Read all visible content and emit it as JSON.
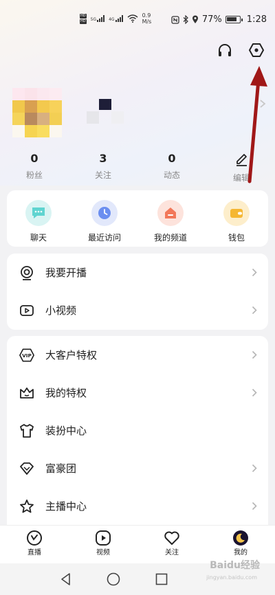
{
  "status_bar": {
    "hd1": "HD",
    "hd2": "HD",
    "net1": "5G",
    "net2": "4G",
    "speed_value": "0.9",
    "speed_unit": "M/s",
    "battery_percent": "77%",
    "time": "1:28"
  },
  "header": {
    "headphones_icon": "headphones-icon",
    "settings_icon": "hexagon-settings-icon"
  },
  "stats": [
    {
      "value": "0",
      "label": "粉丝"
    },
    {
      "value": "3",
      "label": "关注"
    },
    {
      "value": "0",
      "label": "动态"
    }
  ],
  "edit_label": "编辑",
  "quick_actions": [
    {
      "label": "聊天",
      "icon": "chat-icon",
      "color": "#5fd4d0"
    },
    {
      "label": "最近访问",
      "icon": "clock-icon",
      "color": "#6b8ef0"
    },
    {
      "label": "我的频道",
      "icon": "house-icon",
      "color": "#f2785a"
    },
    {
      "label": "钱包",
      "icon": "wallet-icon",
      "color": "#f5b733"
    }
  ],
  "group1": [
    {
      "label": "我要开播",
      "icon": "broadcast-icon"
    },
    {
      "label": "小视频",
      "icon": "video-icon"
    }
  ],
  "group2": [
    {
      "label": "大客户特权",
      "icon": "vip-icon"
    },
    {
      "label": "我的特权",
      "icon": "crown-icon"
    },
    {
      "label": "装扮中心",
      "icon": "shirt-icon"
    },
    {
      "label": "富豪团",
      "icon": "diamond-icon"
    },
    {
      "label": "主播中心",
      "icon": "star-icon"
    }
  ],
  "bottom_nav": [
    {
      "label": "直播",
      "icon": "live-icon"
    },
    {
      "label": "视频",
      "icon": "play-icon"
    },
    {
      "label": "关注",
      "icon": "heart-icon"
    },
    {
      "label": "我的",
      "icon": "profile-moon-icon"
    }
  ],
  "watermark": {
    "text": "Baidu经验",
    "sub": "jingyan.baidu.com"
  },
  "colors": {
    "accent": "#a01818",
    "text": "#222222",
    "muted": "#888888"
  }
}
